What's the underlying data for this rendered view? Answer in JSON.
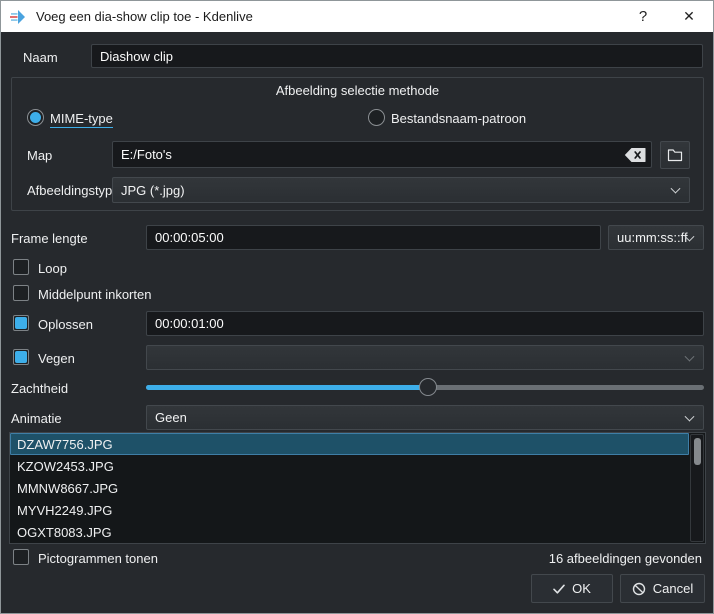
{
  "window": {
    "title": "Voeg een dia-show clip toe - Kdenlive",
    "help_glyph": "?",
    "close_glyph": "✕"
  },
  "colors": {
    "accent": "#3daee9",
    "selection_bg": "#1e5168",
    "titlebar_bg": "#ffffff",
    "body_bg": "#26292d",
    "input_bg": "#17191c"
  },
  "icons": {
    "titlebar": "kdenlive-logo-icon",
    "help": "help-icon",
    "close": "close-icon",
    "clear_field": "clear-backspace-icon",
    "browse": "folder-icon",
    "combo": "chevron-down-icon",
    "ok": "check-icon",
    "cancel": "cancel-circle-icon"
  },
  "form": {
    "name": {
      "label": "Naam",
      "value": "Diashow clip"
    },
    "method_group": {
      "title": "Afbeelding selectie methode",
      "radios": [
        {
          "label": "MIME-type",
          "selected": true
        },
        {
          "label": "Bestandsnaam-patroon",
          "selected": false
        }
      ],
      "folder": {
        "label": "Map",
        "value": "E:/Foto's"
      },
      "image_type": {
        "label": "Afbeeldingstype",
        "value": "JPG (*.jpg)"
      }
    },
    "frame_length": {
      "label": "Frame lengte",
      "value": "00:00:05:00",
      "format": "uu:mm:ss::ff"
    },
    "loop": {
      "label": "Loop",
      "checked": false
    },
    "crop_center": {
      "label": "Middelpunt inkorten",
      "checked": false
    },
    "dissolve": {
      "label": "Oplossen",
      "checked": true,
      "value": "00:00:01:00"
    },
    "wipe": {
      "label": "Vegen",
      "checked": true,
      "value": ""
    },
    "softness": {
      "label": "Zachtheid",
      "percent": 50.5
    },
    "animation": {
      "label": "Animatie",
      "value": "Geen"
    }
  },
  "file_list": {
    "items": [
      "DZAW7756.JPG",
      "KZOW2453.JPG",
      "MMNW8667.JPG",
      "MYVH2249.JPG",
      "OGXT8083.JPG"
    ],
    "selected_index": 0
  },
  "footer": {
    "show_thumbnails": {
      "label": "Pictogrammen tonen",
      "checked": false
    },
    "status": "16 afbeeldingen gevonden",
    "ok_label": "OK",
    "cancel_label": "Cancel"
  }
}
